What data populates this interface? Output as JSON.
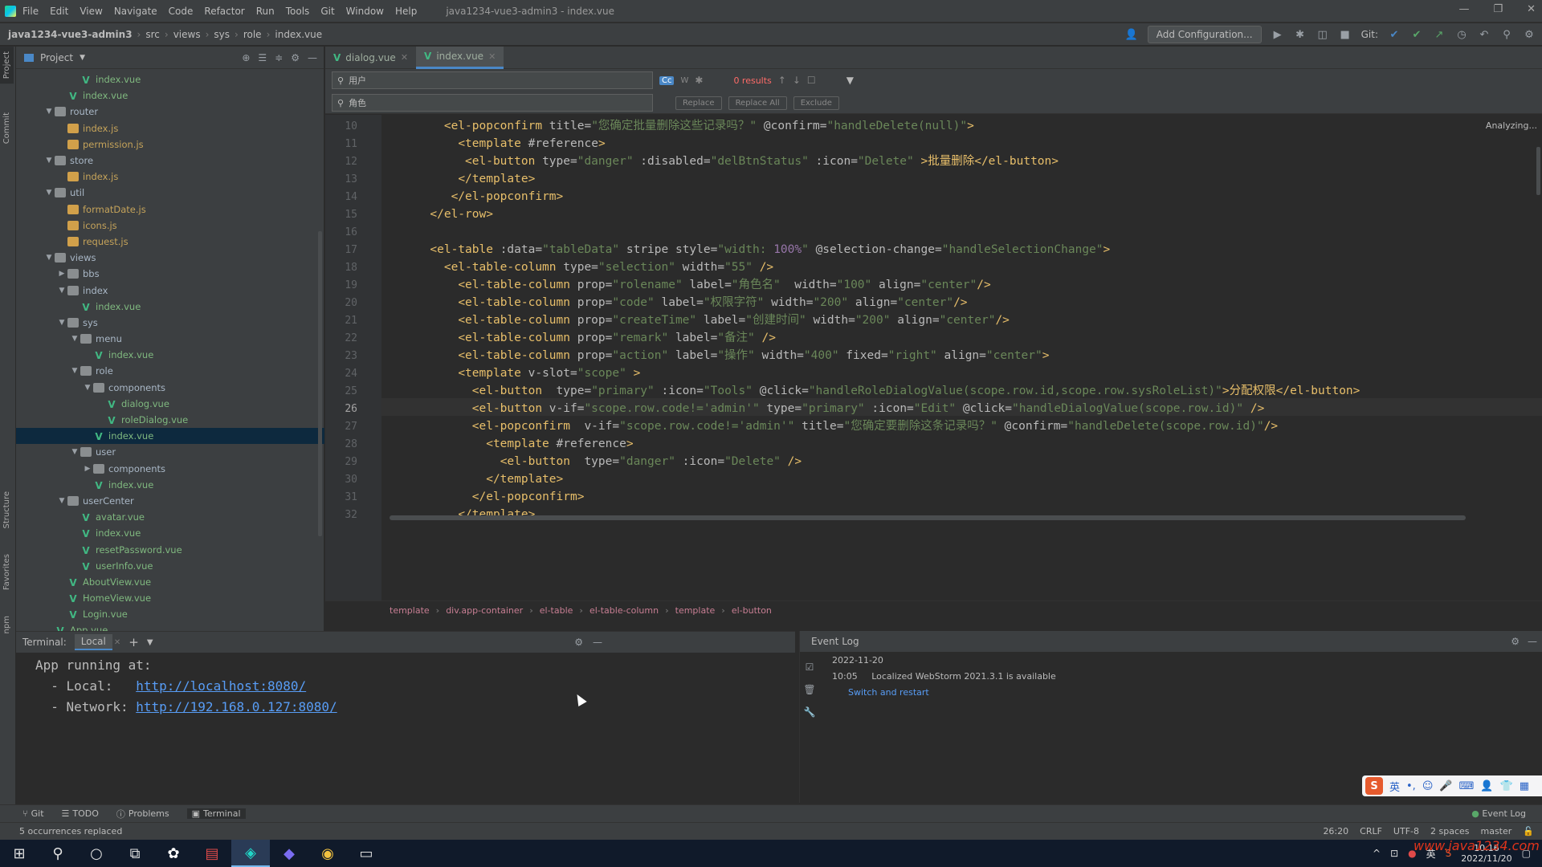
{
  "titlebar": {
    "menu": [
      "File",
      "Edit",
      "View",
      "Navigate",
      "Code",
      "Refactor",
      "Run",
      "Tools",
      "Git",
      "Window",
      "Help"
    ],
    "doc": "java1234-vue3-admin3 - index.vue",
    "controls": [
      "—",
      "❐",
      "✕"
    ]
  },
  "navbar": {
    "crumbs": [
      "java1234-vue3-admin3",
      "src",
      "views",
      "sys",
      "role",
      "index.vue"
    ],
    "add_config": "Add Configuration...",
    "git_label": "Git:"
  },
  "leftstrip": {
    "labels": [
      "Project",
      "Commit",
      "Structure",
      "Favorites",
      "npm"
    ]
  },
  "project": {
    "title": "Project",
    "tree": [
      {
        "depth": 5,
        "type": "vue",
        "name": "index.vue",
        "arrow": ""
      },
      {
        "depth": 4,
        "type": "vue",
        "name": "index.vue",
        "arrow": ""
      },
      {
        "depth": 3,
        "type": "folder",
        "name": "router",
        "arrow": "▼"
      },
      {
        "depth": 4,
        "type": "js",
        "name": "index.js",
        "arrow": ""
      },
      {
        "depth": 4,
        "type": "js",
        "name": "permission.js",
        "arrow": ""
      },
      {
        "depth": 3,
        "type": "folder",
        "name": "store",
        "arrow": "▼"
      },
      {
        "depth": 4,
        "type": "js",
        "name": "index.js",
        "arrow": ""
      },
      {
        "depth": 3,
        "type": "folder",
        "name": "util",
        "arrow": "▼"
      },
      {
        "depth": 4,
        "type": "js",
        "name": "formatDate.js",
        "arrow": ""
      },
      {
        "depth": 4,
        "type": "js",
        "name": "icons.js",
        "arrow": ""
      },
      {
        "depth": 4,
        "type": "js",
        "name": "request.js",
        "arrow": ""
      },
      {
        "depth": 3,
        "type": "folder",
        "name": "views",
        "arrow": "▼"
      },
      {
        "depth": 4,
        "type": "folder",
        "name": "bbs",
        "arrow": "▶"
      },
      {
        "depth": 4,
        "type": "folder",
        "name": "index",
        "arrow": "▼"
      },
      {
        "depth": 5,
        "type": "vue",
        "name": "index.vue",
        "arrow": ""
      },
      {
        "depth": 4,
        "type": "folder",
        "name": "sys",
        "arrow": "▼"
      },
      {
        "depth": 5,
        "type": "folder",
        "name": "menu",
        "arrow": "▼"
      },
      {
        "depth": 6,
        "type": "vue",
        "name": "index.vue",
        "arrow": ""
      },
      {
        "depth": 5,
        "type": "folder",
        "name": "role",
        "arrow": "▼"
      },
      {
        "depth": 6,
        "type": "folder",
        "name": "components",
        "arrow": "▼"
      },
      {
        "depth": 7,
        "type": "vue",
        "name": "dialog.vue",
        "arrow": ""
      },
      {
        "depth": 7,
        "type": "vue",
        "name": "roleDialog.vue",
        "arrow": ""
      },
      {
        "depth": 6,
        "type": "vue",
        "name": "index.vue",
        "arrow": "",
        "selected": true
      },
      {
        "depth": 5,
        "type": "folder",
        "name": "user",
        "arrow": "▼"
      },
      {
        "depth": 6,
        "type": "folder",
        "name": "components",
        "arrow": "▶"
      },
      {
        "depth": 6,
        "type": "vue",
        "name": "index.vue",
        "arrow": ""
      },
      {
        "depth": 4,
        "type": "folder",
        "name": "userCenter",
        "arrow": "▼"
      },
      {
        "depth": 5,
        "type": "vue",
        "name": "avatar.vue",
        "arrow": ""
      },
      {
        "depth": 5,
        "type": "vue",
        "name": "index.vue",
        "arrow": ""
      },
      {
        "depth": 5,
        "type": "vue",
        "name": "resetPassword.vue",
        "arrow": ""
      },
      {
        "depth": 5,
        "type": "vue",
        "name": "userInfo.vue",
        "arrow": ""
      },
      {
        "depth": 4,
        "type": "vue",
        "name": "AboutView.vue",
        "arrow": ""
      },
      {
        "depth": 4,
        "type": "vue",
        "name": "HomeView.vue",
        "arrow": ""
      },
      {
        "depth": 4,
        "type": "vue",
        "name": "Login.vue",
        "arrow": ""
      },
      {
        "depth": 3,
        "type": "vue",
        "name": "App.vue",
        "arrow": ""
      }
    ]
  },
  "tabs": [
    {
      "name": "dialog.vue",
      "active": false
    },
    {
      "name": "index.vue",
      "active": true
    }
  ],
  "findbar": {
    "search": "用户",
    "replace": "角色",
    "results": "0 results",
    "replace_btn": "Replace",
    "replace_all_btn": "Replace All",
    "exclude_btn": "Exclude",
    "cc": "Cc",
    "w": "W"
  },
  "analyzing": "Analyzing...",
  "code": {
    "current_line": 26,
    "lines": [
      {
        "n": "10",
        "indent": "        ",
        "seg": [
          [
            "t",
            "<el-popconfirm "
          ],
          [
            "a",
            "title="
          ],
          [
            "s",
            "\"您确定批量删除这些记录吗？\""
          ],
          [
            "a",
            " @confirm="
          ],
          [
            "s",
            "\"handleDelete(null)\""
          ],
          [
            "t",
            ">"
          ]
        ]
      },
      {
        "n": "11",
        "indent": "          ",
        "seg": [
          [
            "t",
            "<template "
          ],
          [
            "a",
            "#reference"
          ],
          [
            "t",
            ">"
          ]
        ]
      },
      {
        "n": "12",
        "indent": "           ",
        "seg": [
          [
            "t",
            "<el-button "
          ],
          [
            "a",
            "type="
          ],
          [
            "s",
            "\"danger\""
          ],
          [
            "a",
            " :disabled="
          ],
          [
            "s",
            "\"delBtnStatus\""
          ],
          [
            "a",
            " :icon="
          ],
          [
            "s",
            "\"Delete\""
          ],
          [
            "t",
            " >批量删除</el-button>"
          ]
        ]
      },
      {
        "n": "13",
        "indent": "          ",
        "seg": [
          [
            "t",
            "</template>"
          ]
        ]
      },
      {
        "n": "14",
        "indent": "         ",
        "seg": [
          [
            "t",
            "</el-popconfirm>"
          ]
        ]
      },
      {
        "n": "15",
        "indent": "      ",
        "seg": [
          [
            "t",
            "</el-row>"
          ]
        ]
      },
      {
        "n": "16",
        "indent": "",
        "seg": []
      },
      {
        "n": "17",
        "indent": "      ",
        "seg": [
          [
            "t",
            "<el-table "
          ],
          [
            "a",
            ":data="
          ],
          [
            "s",
            "\"tableData\""
          ],
          [
            "a",
            " stripe style="
          ],
          [
            "s",
            "\"width: "
          ],
          [
            "v",
            "100%"
          ],
          [
            "s",
            "\""
          ],
          [
            "a",
            " @selection-change="
          ],
          [
            "s",
            "\"handleSelectionChange\""
          ],
          [
            "t",
            ">"
          ]
        ]
      },
      {
        "n": "18",
        "indent": "        ",
        "seg": [
          [
            "t",
            "<el-table-column "
          ],
          [
            "a",
            "type="
          ],
          [
            "s",
            "\"selection\""
          ],
          [
            "a",
            " width="
          ],
          [
            "s",
            "\"55\""
          ],
          [
            "t",
            " />"
          ]
        ]
      },
      {
        "n": "19",
        "indent": "          ",
        "seg": [
          [
            "t",
            "<el-table-column "
          ],
          [
            "a",
            "prop="
          ],
          [
            "s",
            "\"rolename\""
          ],
          [
            "a",
            " label="
          ],
          [
            "s",
            "\"角色名\""
          ],
          [
            "a",
            "  width="
          ],
          [
            "s",
            "\"100\""
          ],
          [
            "a",
            " align="
          ],
          [
            "s",
            "\"center\""
          ],
          [
            "t",
            "/>"
          ]
        ]
      },
      {
        "n": "20",
        "indent": "          ",
        "seg": [
          [
            "t",
            "<el-table-column "
          ],
          [
            "a",
            "prop="
          ],
          [
            "s",
            "\"code\""
          ],
          [
            "a",
            " label="
          ],
          [
            "s",
            "\"权限字符\""
          ],
          [
            "a",
            " width="
          ],
          [
            "s",
            "\"200\""
          ],
          [
            "a",
            " align="
          ],
          [
            "s",
            "\"center\""
          ],
          [
            "t",
            "/>"
          ]
        ]
      },
      {
        "n": "21",
        "indent": "          ",
        "seg": [
          [
            "t",
            "<el-table-column "
          ],
          [
            "a",
            "prop="
          ],
          [
            "s",
            "\"createTime\""
          ],
          [
            "a",
            " label="
          ],
          [
            "s",
            "\"创建时间\""
          ],
          [
            "a",
            " width="
          ],
          [
            "s",
            "\"200\""
          ],
          [
            "a",
            " align="
          ],
          [
            "s",
            "\"center\""
          ],
          [
            "t",
            "/>"
          ]
        ]
      },
      {
        "n": "22",
        "indent": "          ",
        "seg": [
          [
            "t",
            "<el-table-column "
          ],
          [
            "a",
            "prop="
          ],
          [
            "s",
            "\"remark\""
          ],
          [
            "a",
            " label="
          ],
          [
            "s",
            "\"备注\""
          ],
          [
            "t",
            " />"
          ]
        ]
      },
      {
        "n": "23",
        "indent": "          ",
        "seg": [
          [
            "t",
            "<el-table-column "
          ],
          [
            "a",
            "prop="
          ],
          [
            "s",
            "\"action\""
          ],
          [
            "a",
            " label="
          ],
          [
            "s",
            "\"操作\""
          ],
          [
            "a",
            " width="
          ],
          [
            "s",
            "\"400\""
          ],
          [
            "a",
            " fixed="
          ],
          [
            "s",
            "\"right\""
          ],
          [
            "a",
            " align="
          ],
          [
            "s",
            "\"center\""
          ],
          [
            "t",
            ">"
          ]
        ]
      },
      {
        "n": "24",
        "indent": "          ",
        "seg": [
          [
            "t",
            "<template "
          ],
          [
            "a",
            "v-slot="
          ],
          [
            "s",
            "\"scope\""
          ],
          [
            "t",
            " >"
          ]
        ]
      },
      {
        "n": "25",
        "indent": "            ",
        "seg": [
          [
            "t",
            "<el-button  "
          ],
          [
            "a",
            "type="
          ],
          [
            "s",
            "\"primary\""
          ],
          [
            "a",
            " :icon="
          ],
          [
            "s",
            "\"Tools\""
          ],
          [
            "a",
            " @click="
          ],
          [
            "s",
            "\"handleRoleDialogValue(scope.row.id,scope.row.sysRoleList)\""
          ],
          [
            "t",
            ">分配权限</el-button>"
          ]
        ]
      },
      {
        "n": "26",
        "indent": "            ",
        "seg": [
          [
            "t",
            "<el-button "
          ],
          [
            "a",
            "v-if="
          ],
          [
            "s",
            "\"scope.row.code!='admin'\""
          ],
          [
            "a",
            " type="
          ],
          [
            "s",
            "\"primary\""
          ],
          [
            "a",
            " :icon="
          ],
          [
            "s",
            "\"Edit\""
          ],
          [
            "a",
            " @click="
          ],
          [
            "s",
            "\"handleDialogValue(scope.row.id)\""
          ],
          [
            "t",
            " />"
          ]
        ]
      },
      {
        "n": "27",
        "indent": "            ",
        "seg": [
          [
            "t",
            "<el-popconfirm  "
          ],
          [
            "a",
            "v-if="
          ],
          [
            "s",
            "\"scope.row.code!='admin'\""
          ],
          [
            "a",
            " title="
          ],
          [
            "s",
            "\"您确定要删除这条记录吗？\""
          ],
          [
            "a",
            " @confirm="
          ],
          [
            "s",
            "\"handleDelete(scope.row.id)\""
          ],
          [
            "t",
            "/>"
          ]
        ]
      },
      {
        "n": "28",
        "indent": "              ",
        "seg": [
          [
            "t",
            "<template "
          ],
          [
            "a",
            "#reference"
          ],
          [
            "t",
            ">"
          ]
        ]
      },
      {
        "n": "29",
        "indent": "                ",
        "seg": [
          [
            "t",
            "<el-button  "
          ],
          [
            "a",
            "type="
          ],
          [
            "s",
            "\"danger\""
          ],
          [
            "a",
            " :icon="
          ],
          [
            "s",
            "\"Delete\""
          ],
          [
            "t",
            " />"
          ]
        ]
      },
      {
        "n": "30",
        "indent": "              ",
        "seg": [
          [
            "t",
            "</template>"
          ]
        ]
      },
      {
        "n": "31",
        "indent": "            ",
        "seg": [
          [
            "t",
            "</el-popconfirm>"
          ]
        ]
      },
      {
        "n": "32",
        "indent": "          ",
        "seg": [
          [
            "t",
            "</template>"
          ]
        ]
      }
    ]
  },
  "editor_crumbs": [
    "template",
    "div.app-container",
    "el-table",
    "el-table-column",
    "template",
    "el-button"
  ],
  "terminal": {
    "title": "Terminal:",
    "tab": "Local",
    "line1": "App running at:",
    "local_label": "  - Local:   ",
    "local_url": "http://localhost:8080/",
    "network_label": "  - Network: ",
    "network_url": "http://192.168.0.127:8080/"
  },
  "eventlog": {
    "title": "Event Log",
    "date": "2022-11-20",
    "time": "10:05",
    "message": "Localized WebStorm 2021.3.1 is available",
    "link": "Switch and restart"
  },
  "bottomtabs": [
    "Git",
    "TODO",
    "Problems",
    "Terminal"
  ],
  "bottom_event_log": "Event Log",
  "statusbar": {
    "left": "5 occurrences replaced",
    "right": [
      "26:20",
      "CRLF",
      "UTF-8",
      "2 spaces",
      "master"
    ]
  },
  "taskbar": {
    "clock_time": "10:16",
    "clock_date": "2022/11/20",
    "lang": "英"
  },
  "ime": {
    "label": "S",
    "mode": "英"
  },
  "watermark": "www.java1234.com",
  "colors": {
    "accent": "#4a88c7",
    "tag": "#e8bf6a",
    "string": "#6a8759",
    "attr": "#bababa"
  }
}
